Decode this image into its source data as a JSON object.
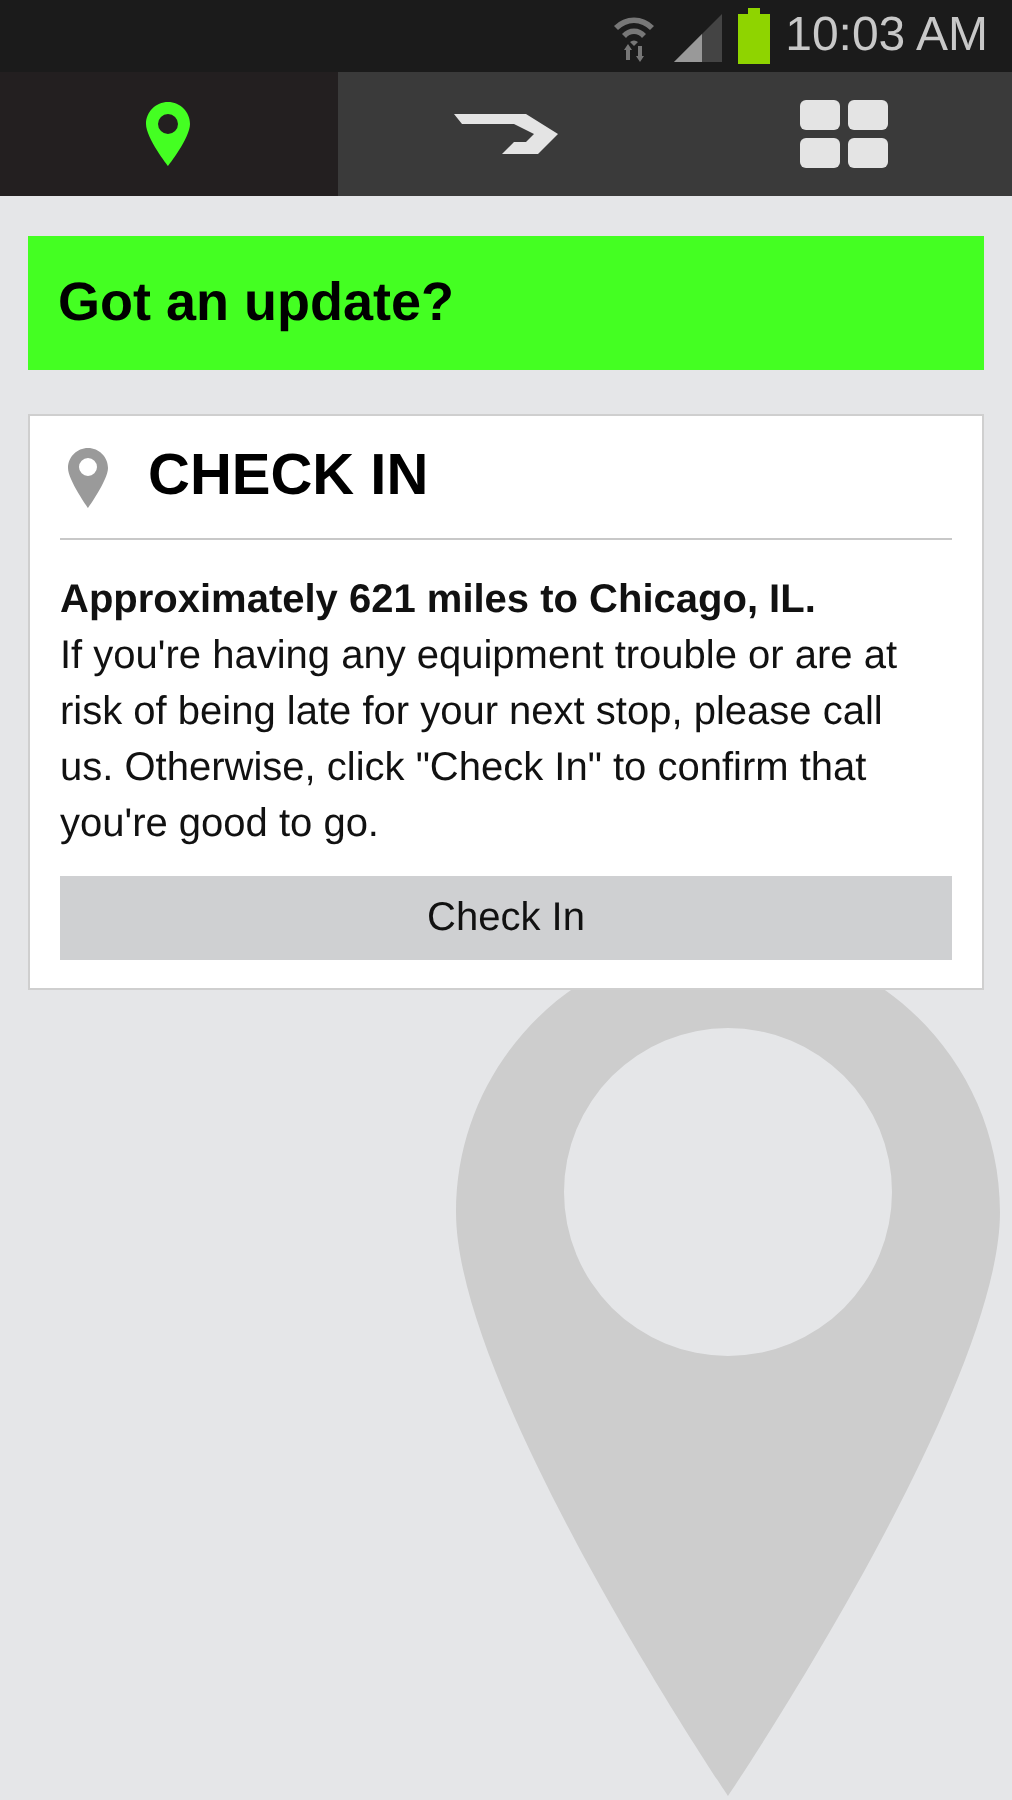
{
  "status_bar": {
    "time": "10:03 AM"
  },
  "tabs": [
    {
      "kind": "pin",
      "selected": true
    },
    {
      "kind": "route",
      "selected": false
    },
    {
      "kind": "grid",
      "selected": false
    }
  ],
  "banner": {
    "title": "Got an update?"
  },
  "card": {
    "title": "CHECK IN",
    "message": "**Approximately 621 miles to Chicago, IL.**\nIf you're having any equipment trouble or are at risk of being late for your next stop, please call us. Otherwise, click \"Check In\" to confirm that you're good to go.",
    "button": "Check In"
  }
}
